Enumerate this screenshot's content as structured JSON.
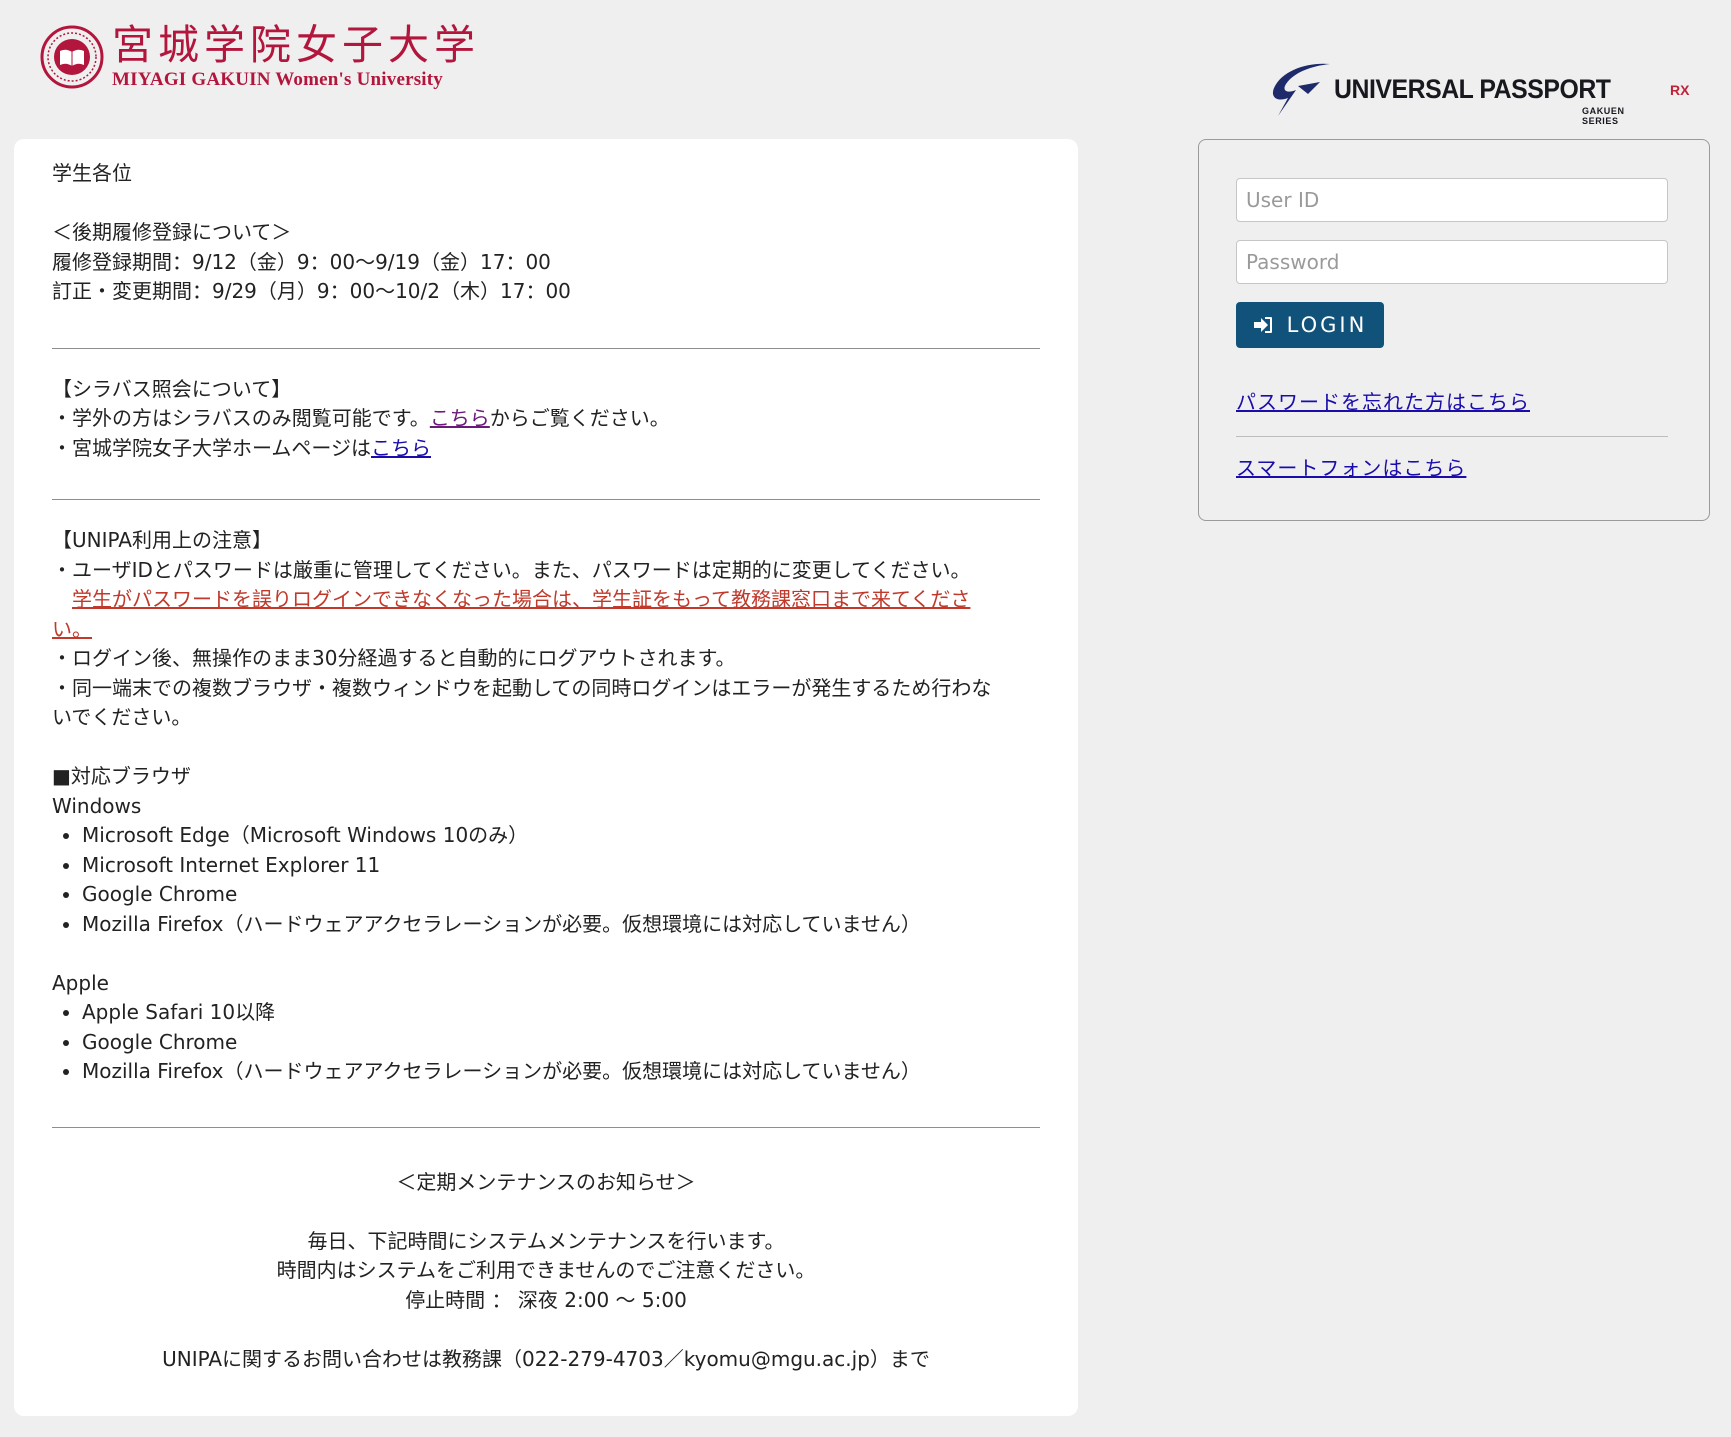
{
  "header": {
    "univ_name_jp": "宮城学院女子大学",
    "univ_name_en": "MIYAGI GAKUIN Women's University",
    "system_name": "UNIVERSAL PASSPORT",
    "system_suffix": "RX",
    "system_series": "GAKUEN SERIES"
  },
  "notice": {
    "greeting": "学生各位",
    "registration": {
      "heading": "＜後期履修登録について＞",
      "period1": "履修登録期間：9/12（金）9：00〜9/19（金）17：00",
      "period2": "訂正・変更期間：9/29（月）9：00〜10/2（木）17：00"
    },
    "syllabus": {
      "heading": "【シラバス照会について】",
      "line1_pre": "・学外の方はシラバスのみ閲覧可能です。",
      "line1_link": "こちら",
      "line1_post": "からご覧ください。",
      "line2_pre": "・宮城学院女子大学ホームページは",
      "line2_link": "こちら"
    },
    "caution": {
      "heading": "【UNIPA利用上の注意】",
      "line1": "・ユーザIDとパスワードは厳重に管理してください。また、パスワードは定期的に変更してください。",
      "red_link_a": "学生がパスワードを誤りログインできなくなった場合は、学生証をもって教務課窓口まで来てくださ",
      "red_link_b": "い。",
      "line2": "・ログイン後、無操作のまま30分経過すると自動的にログアウトされます。",
      "line3a": "・同一端末での複数ブラウザ・複数ウィンドウを起動しての同時ログインはエラーが発生するため行わな",
      "line3b": "いでください。"
    },
    "browsers": {
      "heading": "■対応ブラウザ",
      "windows_label": "Windows",
      "windows": [
        "Microsoft Edge（Microsoft Windows 10のみ）",
        "Microsoft Internet Explorer 11",
        "Google Chrome",
        "Mozilla Firefox（ハードウェアアクセラレーションが必要。仮想環境には対応していません）"
      ],
      "apple_label": "Apple",
      "apple": [
        "Apple Safari 10以降",
        "Google Chrome",
        "Mozilla Firefox（ハードウェアアクセラレーションが必要。仮想環境には対応していません）"
      ]
    },
    "maintenance": {
      "heading": "＜定期メンテナンスのお知らせ＞",
      "line1": "毎日、下記時間にシステムメンテナンスを行います。",
      "line2": "時間内はシステムをご利用できませんのでご注意ください。",
      "line3": "停止時間 ： 深夜 2:00 〜 5:00",
      "contact": "UNIPAに関するお問い合わせは教務課（022-279-4703／kyomu@mgu.ac.jp）まで"
    }
  },
  "login": {
    "user_id_placeholder": "User ID",
    "password_placeholder": "Password",
    "login_label": "LOGIN",
    "forgot_password": "パスワードを忘れた方はこちら",
    "smartphone": "スマートフォンはこちら"
  },
  "colors": {
    "brand_red": "#b2163c",
    "login_button": "#11527a",
    "link": "#1a0dab",
    "alert_link": "#c0392b"
  }
}
